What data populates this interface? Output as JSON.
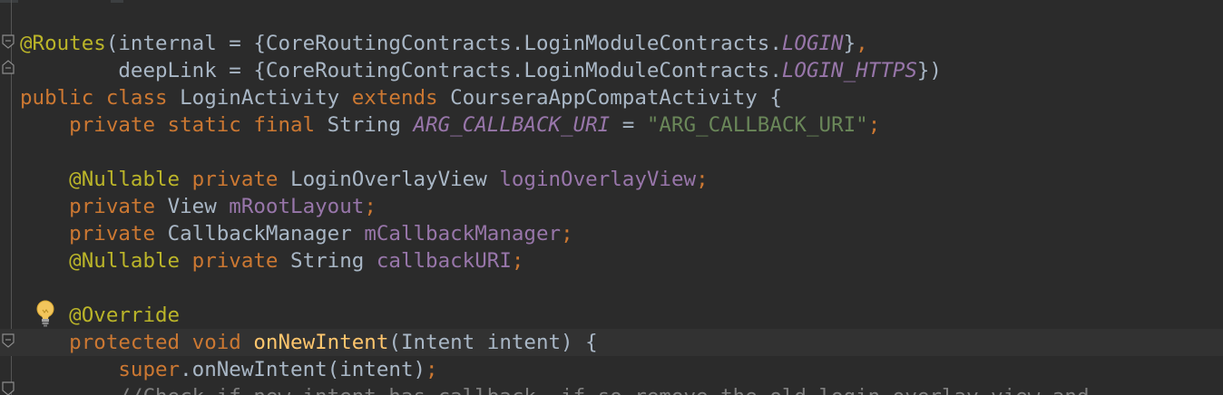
{
  "editor": {
    "theme_colors": {
      "background": "#2b2b2b",
      "keyword": "#cc7832",
      "annotation": "#bbb529",
      "string": "#6a8759",
      "field": "#9876aa",
      "method": "#ffc66d",
      "default": "#a9b7c6",
      "comment": "#808080"
    },
    "gutter_icons": [
      "fold-marker-icon",
      "lightbulb-icon"
    ],
    "lines": [
      {
        "tokens": [
          {
            "t": "@Routes",
            "c": "ann"
          },
          {
            "t": "(internal = {CoreRoutingContracts.LoginModuleContracts.",
            "c": ""
          },
          {
            "t": "LOGIN",
            "c": "cst"
          },
          {
            "t": "}",
            "c": ""
          },
          {
            "t": ",",
            "c": "kw"
          }
        ]
      },
      {
        "tokens": [
          {
            "t": "        deepLink = {CoreRoutingContracts.LoginModuleContracts.",
            "c": ""
          },
          {
            "t": "LOGIN_HTTPS",
            "c": "cst"
          },
          {
            "t": "})",
            "c": ""
          }
        ]
      },
      {
        "tokens": [
          {
            "t": "public class ",
            "c": "kw"
          },
          {
            "t": "LoginActivity ",
            "c": ""
          },
          {
            "t": "extends ",
            "c": "kw"
          },
          {
            "t": "CourseraAppCompatActivity {",
            "c": ""
          }
        ]
      },
      {
        "tokens": [
          {
            "t": "    private static final ",
            "c": "kw"
          },
          {
            "t": "String ",
            "c": ""
          },
          {
            "t": "ARG_CALLBACK_URI",
            "c": "cst"
          },
          {
            "t": " = ",
            "c": ""
          },
          {
            "t": "\"ARG_CALLBACK_URI\"",
            "c": "str"
          },
          {
            "t": ";",
            "c": "kw"
          }
        ]
      },
      {
        "tokens": []
      },
      {
        "tokens": [
          {
            "t": "    @Nullable ",
            "c": "ann"
          },
          {
            "t": "private ",
            "c": "kw"
          },
          {
            "t": "LoginOverlayView ",
            "c": ""
          },
          {
            "t": "loginOverlayView",
            "c": "fld"
          },
          {
            "t": ";",
            "c": "kw"
          }
        ]
      },
      {
        "tokens": [
          {
            "t": "    private ",
            "c": "kw"
          },
          {
            "t": "View ",
            "c": ""
          },
          {
            "t": "mRootLayout",
            "c": "fld"
          },
          {
            "t": ";",
            "c": "kw"
          }
        ]
      },
      {
        "tokens": [
          {
            "t": "    private ",
            "c": "kw"
          },
          {
            "t": "CallbackManager ",
            "c": ""
          },
          {
            "t": "mCallbackManager",
            "c": "fld"
          },
          {
            "t": ";",
            "c": "kw"
          }
        ]
      },
      {
        "tokens": [
          {
            "t": "    @Nullable ",
            "c": "ann"
          },
          {
            "t": "private ",
            "c": "kw"
          },
          {
            "t": "String ",
            "c": ""
          },
          {
            "t": "callbackURI",
            "c": "fld"
          },
          {
            "t": ";",
            "c": "kw"
          }
        ]
      },
      {
        "tokens": []
      },
      {
        "tokens": [
          {
            "t": "    @Override",
            "c": "ann"
          }
        ]
      },
      {
        "current": true,
        "tokens": [
          {
            "t": "    protected void ",
            "c": "kw"
          },
          {
            "t": "onNewIntent",
            "c": "mth"
          },
          {
            "t": "(Intent intent) {",
            "c": ""
          }
        ]
      },
      {
        "tokens": [
          {
            "t": "        super",
            "c": "kw"
          },
          {
            "t": ".onNewIntent(intent)",
            "c": ""
          },
          {
            "t": ";",
            "c": "kw"
          }
        ]
      },
      {
        "tokens": [
          {
            "t": "        //Check if new intent has callback, if so remove the old login overlay view and",
            "c": "cmt"
          }
        ]
      }
    ]
  }
}
